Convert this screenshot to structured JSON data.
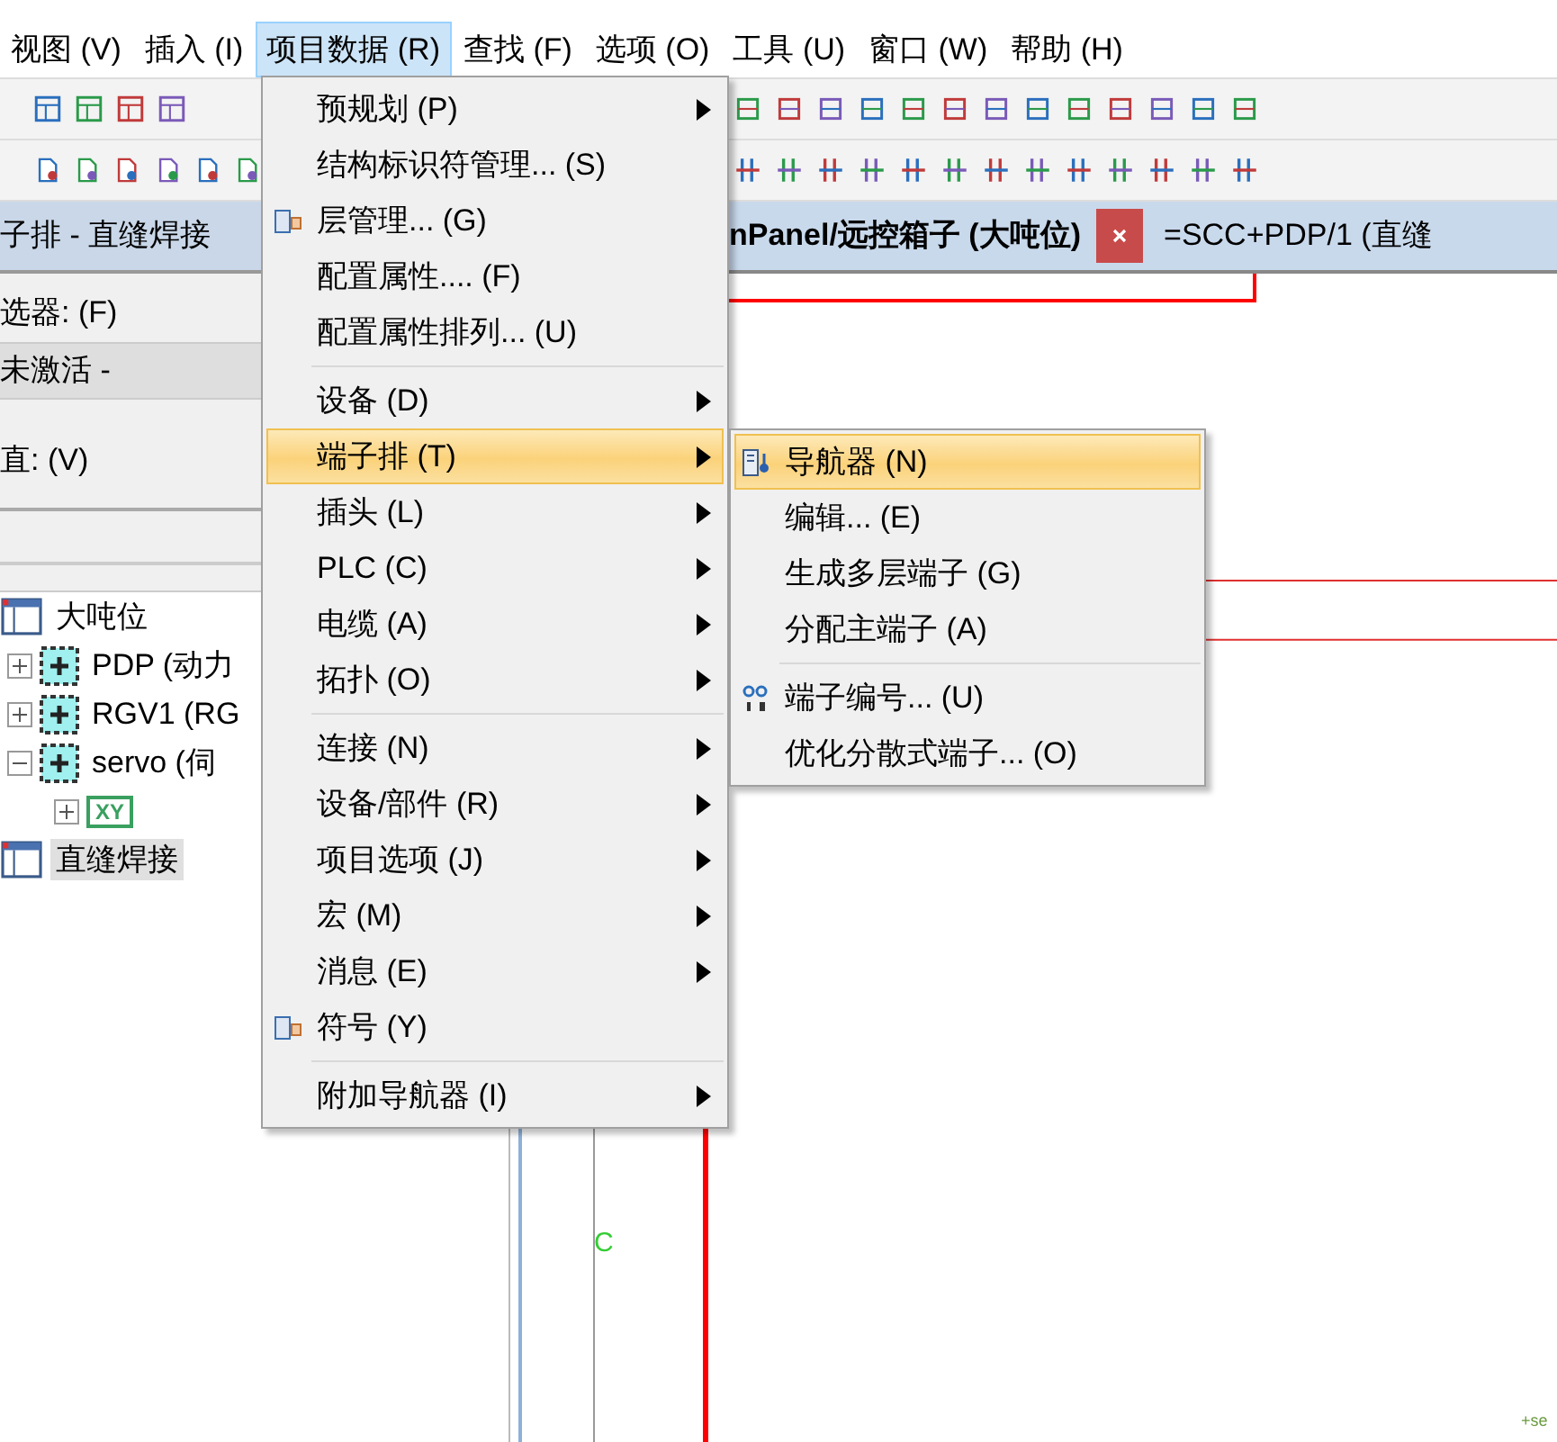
{
  "menubar": [
    {
      "label": "视图 (V)",
      "selected": false
    },
    {
      "label": "插入 (I)",
      "selected": false
    },
    {
      "label": "项目数据 (R)",
      "selected": true
    },
    {
      "label": "查找 (F)",
      "selected": false
    },
    {
      "label": "选项 (O)",
      "selected": false
    },
    {
      "label": "工具 (U)",
      "selected": false
    },
    {
      "label": "窗口 (W)",
      "selected": false
    },
    {
      "label": "帮助 (H)",
      "selected": false
    }
  ],
  "left_panel": {
    "title": "子排 - 直缝焊接",
    "filter_label": "选器: (F)",
    "filter_value": "未激活 -",
    "value_label": "直: (V)",
    "tree": [
      {
        "label": "大吨位",
        "kind": "project",
        "selected": false,
        "children": [
          {
            "label": "PDP (动力",
            "kind": "device",
            "expanded": false,
            "selected": false
          },
          {
            "label": "RGV1 (RG",
            "kind": "device",
            "expanded": false,
            "selected": false
          },
          {
            "label": "servo (伺",
            "kind": "device",
            "expanded": true,
            "selected": false,
            "children": [
              {
                "label": "XY",
                "kind": "xy",
                "expanded": false,
                "selected": false
              }
            ]
          }
        ]
      },
      {
        "label": "直缝焊接",
        "kind": "project",
        "selected": true
      }
    ]
  },
  "tabs": [
    {
      "label": "nPanel/远控箱子 (大吨位)",
      "selected": true,
      "closable": true
    },
    {
      "label": "=SCC+PDP/1 (直缝",
      "selected": false,
      "closable": false
    }
  ],
  "canvas": {
    "labels": [
      {
        "text": "C"
      },
      {
        "text": "+se"
      }
    ]
  },
  "menu": {
    "items": [
      {
        "kind": "submenu",
        "label": "预规划 (P)",
        "selected": false
      },
      {
        "kind": "command",
        "label": "结构标识符管理... (S)",
        "selected": false
      },
      {
        "kind": "command",
        "label": "层管理... (G)",
        "icon": true,
        "selected": false
      },
      {
        "kind": "command",
        "label": "配置属性.... (F)",
        "selected": false
      },
      {
        "kind": "command",
        "label": "配置属性排列... (U)",
        "selected": false
      },
      {
        "kind": "separator"
      },
      {
        "kind": "submenu",
        "label": "设备 (D)",
        "selected": false
      },
      {
        "kind": "submenu",
        "label": "端子排 (T)",
        "selected": true
      },
      {
        "kind": "submenu",
        "label": "插头 (L)",
        "selected": false
      },
      {
        "kind": "submenu",
        "label": "PLC (C)",
        "selected": false
      },
      {
        "kind": "submenu",
        "label": "电缆 (A)",
        "selected": false
      },
      {
        "kind": "submenu",
        "label": "拓扑 (O)",
        "selected": false
      },
      {
        "kind": "separator"
      },
      {
        "kind": "submenu",
        "label": "连接 (N)",
        "selected": false
      },
      {
        "kind": "submenu",
        "label": "设备/部件 (R)",
        "selected": false
      },
      {
        "kind": "submenu",
        "label": "项目选项 (J)",
        "selected": false
      },
      {
        "kind": "submenu",
        "label": "宏 (M)",
        "selected": false
      },
      {
        "kind": "submenu",
        "label": "消息 (E)",
        "selected": false
      },
      {
        "kind": "command",
        "label": "符号 (Y)",
        "icon": true,
        "selected": false
      },
      {
        "kind": "separator"
      },
      {
        "kind": "submenu",
        "label": "附加导航器 (I)",
        "selected": false
      }
    ]
  },
  "submenu": {
    "items": [
      {
        "kind": "command",
        "label": "导航器 (N)",
        "icon": true,
        "selected": true
      },
      {
        "kind": "command",
        "label": "编辑... (E)",
        "selected": false
      },
      {
        "kind": "command",
        "label": "生成多层端子 (G)",
        "selected": false
      },
      {
        "kind": "command",
        "label": "分配主端子 (A)",
        "selected": false
      },
      {
        "kind": "separator"
      },
      {
        "kind": "command",
        "label": "端子编号... (U)",
        "icon": true,
        "selected": false
      },
      {
        "kind": "command",
        "label": "优化分散式端子... (O)",
        "selected": false
      }
    ]
  }
}
